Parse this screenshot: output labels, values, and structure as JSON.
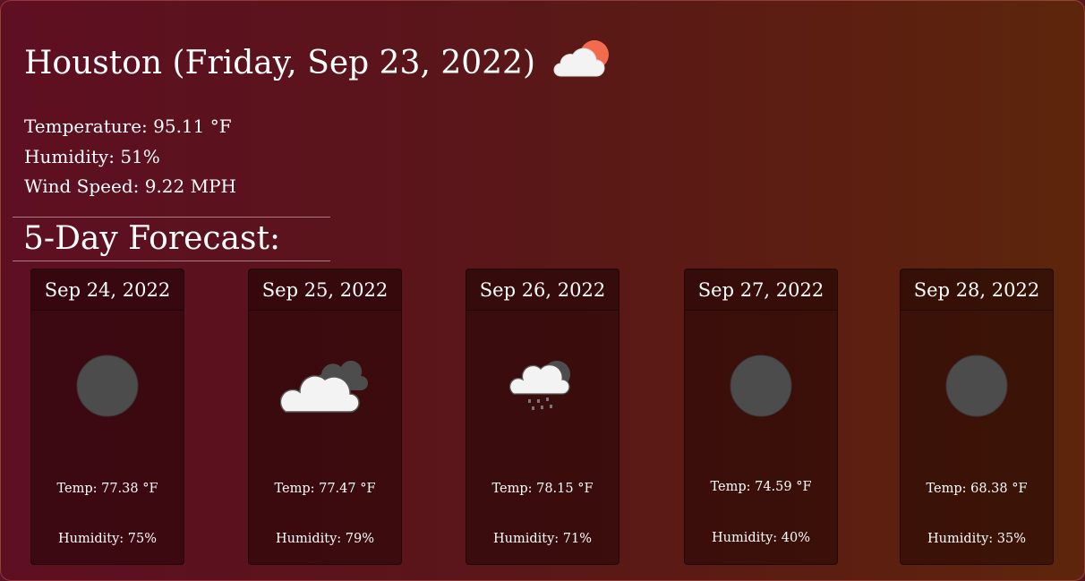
{
  "current": {
    "title": "Houston (Friday, Sep 23, 2022)",
    "icon": "cloud-sun-icon",
    "temperature": "Temperature: 95.11 °F",
    "humidity": "Humidity: 51%",
    "wind": "Wind Speed: 9.22 MPH"
  },
  "forecast": {
    "heading": "5-Day Forecast:",
    "days": [
      {
        "date": "Sep 24, 2022",
        "icon": "moon-icon",
        "temp": "Temp: 77.38 °F",
        "humidity": "Humidity: 75%"
      },
      {
        "date": "Sep 25, 2022",
        "icon": "clouds-icon",
        "temp": "Temp: 77.47 °F",
        "humidity": "Humidity: 79%"
      },
      {
        "date": "Sep 26, 2022",
        "icon": "rain-icon",
        "temp": "Temp: 78.15 °F",
        "humidity": "Humidity: 71%"
      },
      {
        "date": "Sep 27, 2022",
        "icon": "moon-icon",
        "temp": "Temp: 74.59 °F",
        "humidity": "Humidity: 40%"
      },
      {
        "date": "Sep 28, 2022",
        "icon": "moon-icon",
        "temp": "Temp: 68.38 °F",
        "humidity": "Humidity: 35%"
      }
    ]
  },
  "colors": {
    "sun": "#f26b4f",
    "cloud_white": "#f3f3f3",
    "cloud_gray": "#4d4d4d",
    "moon": "#4c4c4c"
  }
}
